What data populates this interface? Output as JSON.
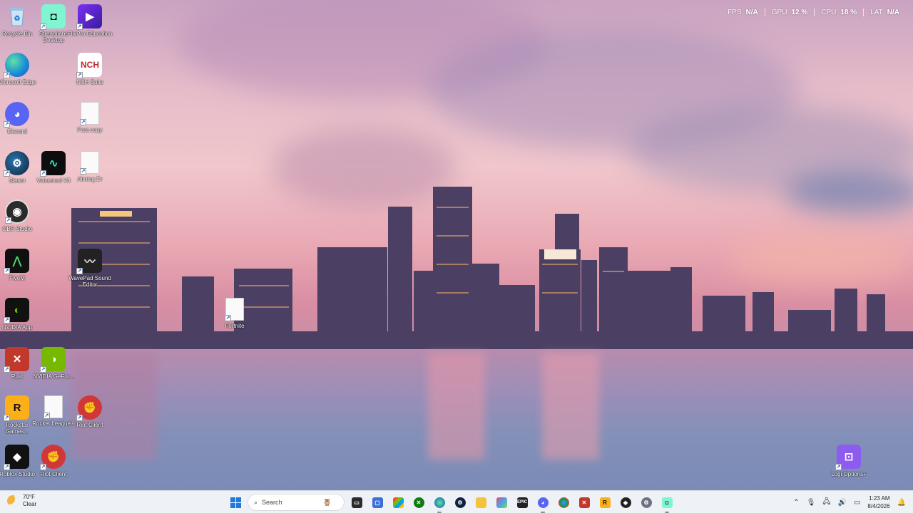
{
  "overlay": {
    "items": [
      {
        "key": "FPS",
        "value": "N/A"
      },
      {
        "key": "GPU",
        "value": "12 %"
      },
      {
        "key": "CPU",
        "value": "18 %"
      },
      {
        "key": "LAT",
        "value": "N/A"
      }
    ]
  },
  "desktop": {
    "icons": {
      "recycle_bin": "Recycle Bin",
      "streamlabs": "Streamlabs Desktop",
      "filmora": "FlixPro Education",
      "edge": "Microsoft Edge",
      "nch": "NCH Suite",
      "discord": "Discord",
      "text_file": "Fast.copy",
      "steam": "Steam",
      "voicemod": "Voicemod V3",
      "aiming_file": "Aiming Dr",
      "obs": "OBS Studio",
      "fivem": "FiveM",
      "wavepad": "WavePad Sound Editor",
      "fortnite": "Fortnite",
      "nvidia_app": "NVIDIA App",
      "rust": "Rust",
      "geforce": "NVIDIA GeFor...",
      "rockstar": "Rockstar Games...",
      "rocket_league": "Rocket League®",
      "riot_client_1": "Riot Client",
      "roblox": "Roblox Studio",
      "riot_client_2": "Riot Client",
      "logi": "Logi Options+"
    }
  },
  "taskbar": {
    "weather": {
      "temp": "70°F",
      "condition": "Clear"
    },
    "search_placeholder": "Search",
    "apps": [
      "file-explorer",
      "store",
      "xbox",
      "edge",
      "steam",
      "folder",
      "photos",
      "epic-games",
      "discord",
      "chrome",
      "rust",
      "rockstar",
      "ea",
      "settings",
      "streamlabs"
    ],
    "clock": {
      "time": "1:23 AM",
      "date": "8/4/2026"
    }
  },
  "colors": {
    "taskbar_bg": "#eef1f6",
    "accent": "#1f7ae0",
    "sky_pink": "#e9a9b4",
    "water_blue": "#8390b9"
  }
}
